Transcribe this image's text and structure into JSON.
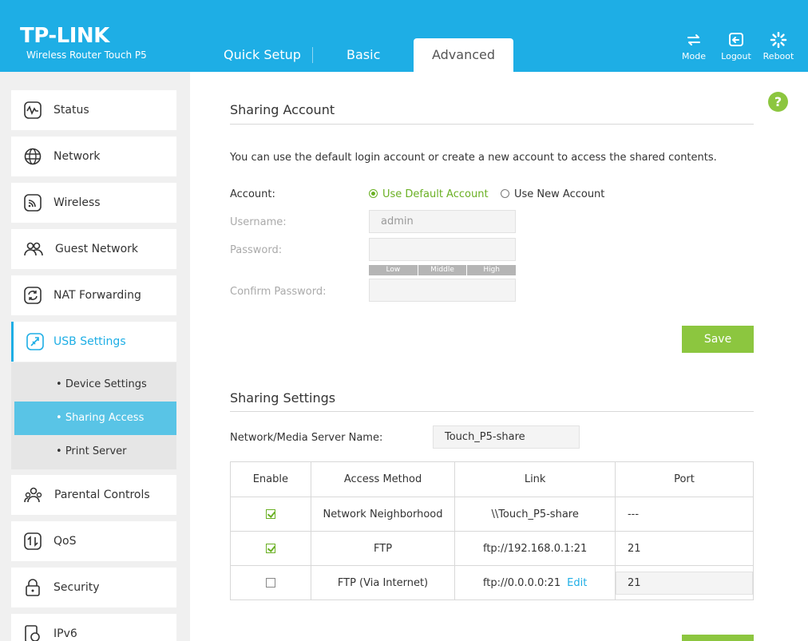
{
  "header": {
    "logo": "TP-LINK",
    "model": "Wireless Router Touch P5",
    "tabs": {
      "quick_setup": "Quick Setup",
      "basic": "Basic",
      "advanced": "Advanced"
    },
    "actions": {
      "mode": "Mode",
      "logout": "Logout",
      "reboot": "Reboot"
    }
  },
  "sidebar": {
    "items": [
      {
        "label": "Status",
        "icon": "status-icon"
      },
      {
        "label": "Network",
        "icon": "globe-icon"
      },
      {
        "label": "Wireless",
        "icon": "wireless-icon"
      },
      {
        "label": "Guest Network",
        "icon": "guest-icon"
      },
      {
        "label": "NAT Forwarding",
        "icon": "nat-icon"
      },
      {
        "label": "USB Settings",
        "icon": "usb-icon"
      },
      {
        "label": "Parental Controls",
        "icon": "parental-icon"
      },
      {
        "label": "QoS",
        "icon": "qos-icon"
      },
      {
        "label": "Security",
        "icon": "lock-icon"
      },
      {
        "label": "IPv6",
        "icon": "ipv6-icon"
      }
    ],
    "usb_sub": [
      "Device Settings",
      "Sharing Access",
      "Print Server"
    ]
  },
  "sharing_account": {
    "title": "Sharing Account",
    "description": "You can use the default login account or create a new account to access the shared contents.",
    "account_label": "Account:",
    "option_default": "Use Default Account",
    "option_new": "Use New Account",
    "username_label": "Username:",
    "username_value": "admin",
    "password_label": "Password:",
    "confirm_label": "Confirm Password:",
    "strength": [
      "Low",
      "Middle",
      "High"
    ],
    "save": "Save"
  },
  "sharing_settings": {
    "title": "Sharing Settings",
    "server_name_label": "Network/Media Server Name:",
    "server_name_value": "Touch_P5-share",
    "columns": [
      "Enable",
      "Access Method",
      "Link",
      "Port"
    ],
    "rows": [
      {
        "enabled": true,
        "method": "Network Neighborhood",
        "link": "\\\\Touch_P5-share",
        "port": "---"
      },
      {
        "enabled": true,
        "method": "FTP",
        "link": "ftp://192.168.0.1:21",
        "port": "21"
      },
      {
        "enabled": false,
        "method": "FTP (Via Internet)",
        "link": "ftp://0.0.0.0:21",
        "edit": "Edit",
        "port": "21"
      }
    ]
  },
  "colors": {
    "brand": "#1eaee5",
    "accent": "#8cc63f",
    "submenu_active": "#59c4e6"
  }
}
